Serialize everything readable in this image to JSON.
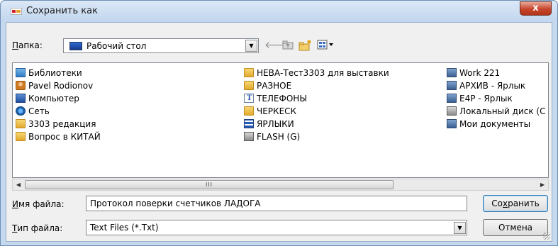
{
  "window": {
    "title": "Сохранить как",
    "close_label": "x"
  },
  "toolbar": {
    "folder_label_key": "П",
    "folder_label_rest": "апка:",
    "folder_value": "Рабочий стол",
    "icons": [
      "back-arrow-icon",
      "up-folder-icon",
      "new-folder-icon",
      "view-menu-icon"
    ]
  },
  "files": {
    "col1": [
      {
        "label": "Библиотеки",
        "icon": "library-icon"
      },
      {
        "label": "Pavel Rodionov",
        "icon": "user-folder-icon"
      },
      {
        "label": "Компьютер",
        "icon": "computer-icon"
      },
      {
        "label": "Сеть",
        "icon": "network-icon"
      },
      {
        "label": "3303 редакция",
        "icon": "folder-icon"
      },
      {
        "label": "Вопрос в КИТАЙ",
        "icon": "folder-icon"
      }
    ],
    "col2": [
      {
        "label": "НЕВА-Тест3303 для выставки",
        "icon": "folder-icon"
      },
      {
        "label": "РАЗНОЕ",
        "icon": "folder-icon"
      },
      {
        "label": "ТЕЛЕФОНЫ",
        "icon": "text-document-icon"
      },
      {
        "label": "ЧЕРКЕСК",
        "icon": "folder-icon"
      },
      {
        "label": "ЯРЛЫКИ",
        "icon": "grid-icon"
      },
      {
        "label": "FLASH (G)",
        "icon": "drive-icon"
      }
    ],
    "col3": [
      {
        "label": "Work 221",
        "icon": "shortcut-icon"
      },
      {
        "label": "АРХИВ - Ярлык",
        "icon": "shortcut-icon"
      },
      {
        "label": "Е4Р - Ярлык",
        "icon": "shortcut-icon"
      },
      {
        "label": "Локальный диск (С",
        "icon": "drive-icon"
      },
      {
        "label": "Мои документы",
        "icon": "shortcut-icon"
      }
    ]
  },
  "scrollbar": {
    "thumb_grip": "III",
    "left_arrow": "◀",
    "right_arrow": "▶"
  },
  "filename": {
    "label_key": "И",
    "label_rest": "мя файла:",
    "value": "Протокол поверки счетчиков ЛАДОГА"
  },
  "filetype": {
    "label_key": "Т",
    "label_rest": "ип файла:",
    "value": "Text Files (*.Txt)"
  },
  "buttons": {
    "save_pre": "Со",
    "save_key": "х",
    "save_post": "ранить",
    "cancel": "Отмена"
  },
  "colors": {
    "title_bar": "#c2d6ee",
    "close_button": "#c7452b",
    "dialog_bg": "#f0f0f0",
    "default_button_border": "#3c7fb1"
  }
}
